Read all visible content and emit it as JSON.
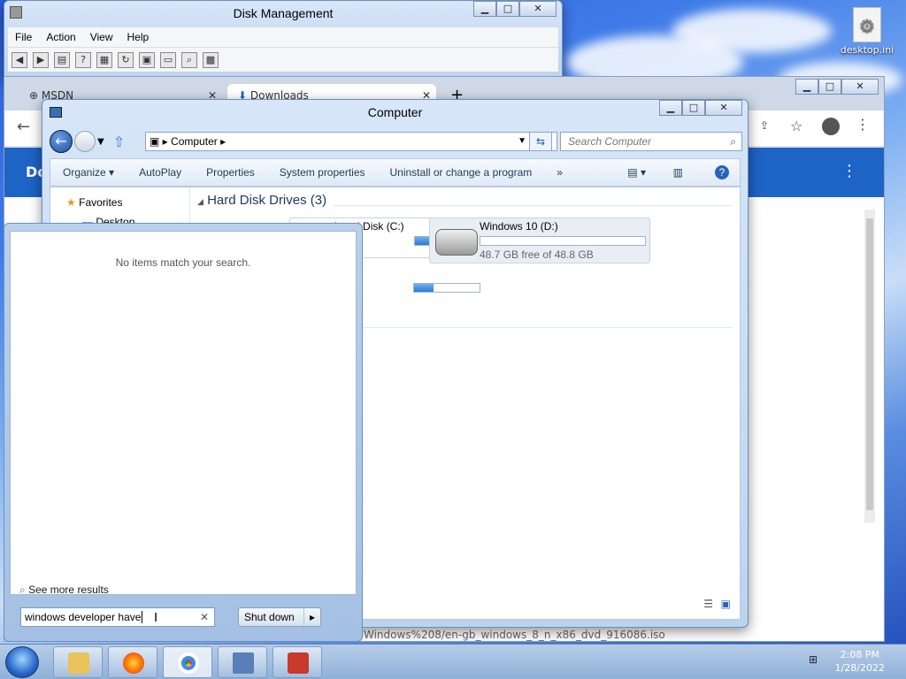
{
  "desktop": {
    "icon_label": "desktop.ini"
  },
  "disk_management": {
    "title": "Disk Management",
    "menu": [
      "File",
      "Action",
      "View",
      "Help"
    ]
  },
  "chrome": {
    "tabs": [
      {
        "label": "MSDN"
      },
      {
        "label": "Downloads"
      }
    ],
    "page_header_text": "Do",
    "download_status": "Windows%208/en-gb_windows_8_n_x86_dvd_916086.iso"
  },
  "explorer": {
    "title": "Computer",
    "address": "Computer",
    "search_placeholder": "Search Computer",
    "commands": [
      "Organize",
      "AutoPlay",
      "Properties",
      "System properties",
      "Uninstall or change a program"
    ],
    "more": "»",
    "nav": {
      "favorites": "Favorites",
      "desktop": "Desktop"
    },
    "group_title": "Hard Disk Drives (3)",
    "drives": [
      {
        "name": "Local Disk (C:)",
        "free": "",
        "fill": 0.4
      },
      {
        "name": "Windows 10 (D:)",
        "free": "48.7 GB free of 48.8 GB",
        "fill": 0.002
      },
      {
        "name": "",
        "free": "",
        "fill": 0.3
      }
    ]
  },
  "start_menu": {
    "no_items": "No items match your search.",
    "see_more": "See more results",
    "search_value": "windows developer have",
    "shutdown_label": "Shut down"
  },
  "taskbar": {
    "time": "2:08 PM",
    "date": "1/28/2022"
  },
  "colors": {
    "accent": "#1e63c6",
    "taskbar": "#9bb8de"
  }
}
